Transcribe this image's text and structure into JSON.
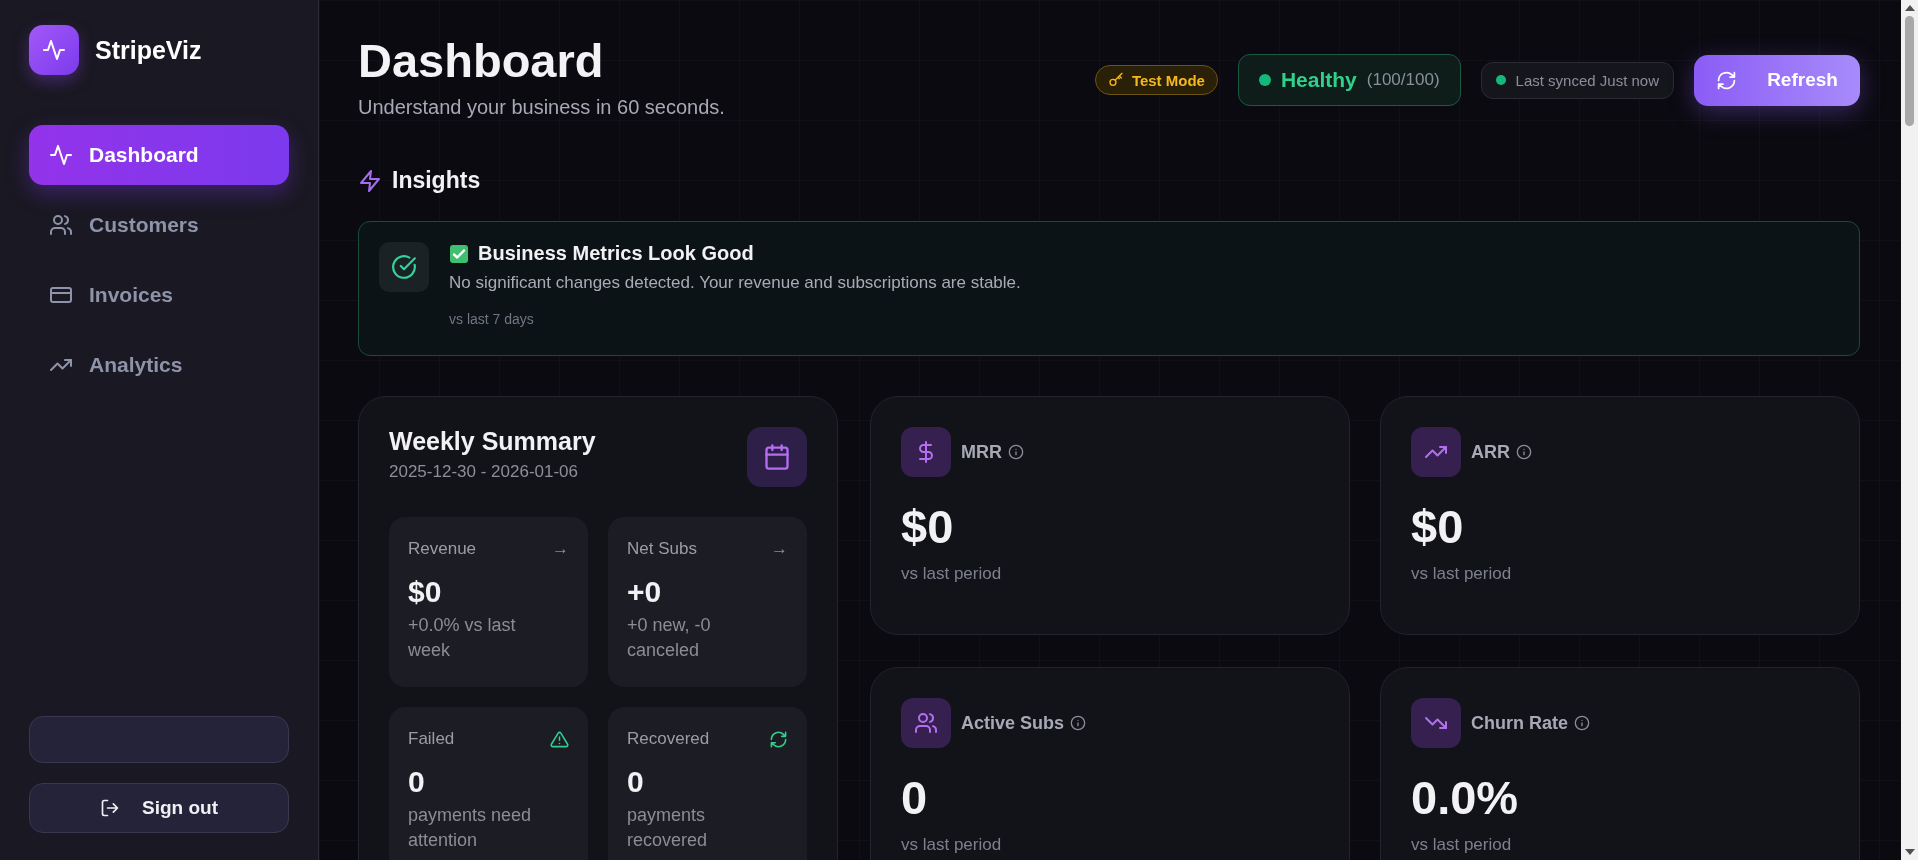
{
  "app": {
    "name": "StripeViz"
  },
  "nav": [
    {
      "label": "Dashboard",
      "kind": "pulse",
      "selected": true
    },
    {
      "label": "Customers",
      "kind": "users",
      "selected": false
    },
    {
      "label": "Invoices",
      "kind": "card",
      "selected": false
    },
    {
      "label": "Analytics",
      "kind": "trend",
      "selected": false
    }
  ],
  "sign_out": {
    "label": "Sign out"
  },
  "header": {
    "title": "Dashboard",
    "subtitle": "Understand your business in 60 seconds.",
    "test_mode": "Test Mode",
    "health": {
      "status": "Healthy",
      "score": "(100/100)"
    },
    "sync": "Last synced Just now",
    "refresh": "Refresh"
  },
  "insights": {
    "title": "Insights",
    "cards": [
      {
        "title": "Business Metrics Look Good",
        "body": "No significant changes detected. Your revenue and subscriptions are stable.",
        "note": "vs last 7 days"
      }
    ]
  },
  "weekly": {
    "title": "Weekly Summary",
    "range": "2025-12-30 - 2026-01-06",
    "tiles": [
      {
        "label": "Revenue",
        "kind": "arrow",
        "trend": "→",
        "value": "$0",
        "note": "+0.0% vs last week"
      },
      {
        "label": "Net Subs",
        "kind": "arrow",
        "trend": "→",
        "value": "+0",
        "note": "+0 new, -0 canceled"
      },
      {
        "label": "Failed",
        "kind": "warning",
        "value": "0",
        "note": "payments need attention"
      },
      {
        "label": "Recovered",
        "kind": "recovered",
        "value": "0",
        "note": "payments recovered"
      }
    ]
  },
  "metrics": [
    {
      "label": "MRR",
      "kind": "money",
      "value": "$0",
      "note": "vs last period"
    },
    {
      "label": "ARR",
      "kind": "trend",
      "value": "$0",
      "note": "vs last period"
    },
    {
      "label": "Active Subs",
      "kind": "users",
      "value": "0",
      "note": "vs last period"
    },
    {
      "label": "Churn Rate",
      "kind": "decline",
      "value": "0.0%",
      "note": "vs last period"
    }
  ]
}
